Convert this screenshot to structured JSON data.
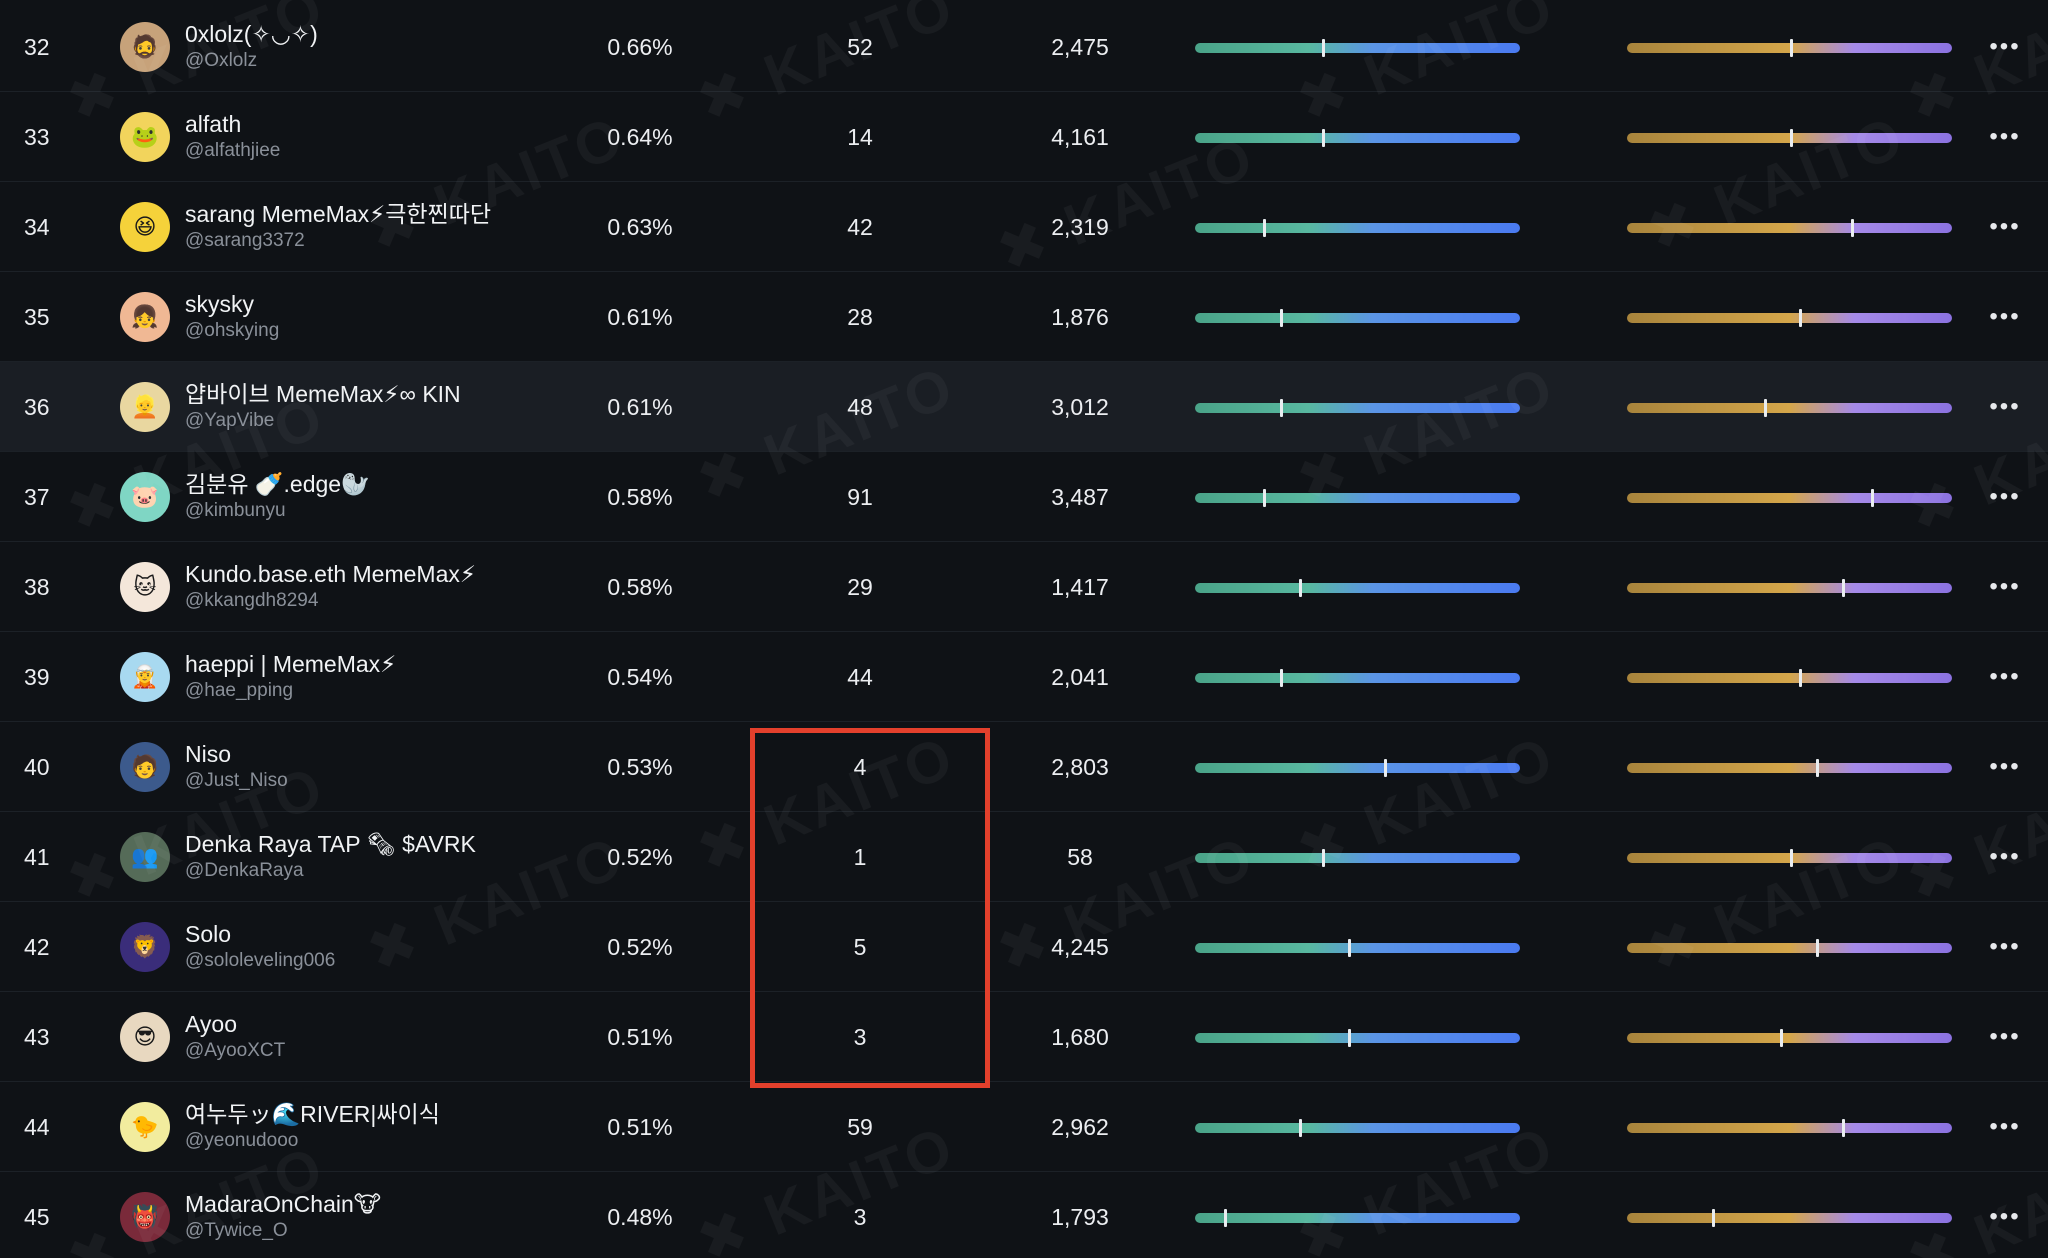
{
  "watermark_text": "✖ KAITO",
  "more_label": "•••",
  "rows": [
    {
      "rank": "32",
      "name": "0xlolz(✧◡✧)",
      "handle": "@Oxlolz",
      "share": "0.66%",
      "count": "52",
      "followers": "2,475",
      "bar_a": 0.39,
      "bar_b": 0.5,
      "avatar_color": "#c7a27a",
      "avatar_glyph": "🧔",
      "highlight": false
    },
    {
      "rank": "33",
      "name": "alfath",
      "handle": "@alfathjiee",
      "share": "0.64%",
      "count": "14",
      "followers": "4,161",
      "bar_a": 0.39,
      "bar_b": 0.5,
      "avatar_color": "#f2d45c",
      "avatar_glyph": "🐸",
      "highlight": false
    },
    {
      "rank": "34",
      "name": "sarang MemeMax⚡극한찐따단",
      "handle": "@sarang3372",
      "share": "0.63%",
      "count": "42",
      "followers": "2,319",
      "bar_a": 0.21,
      "bar_b": 0.69,
      "avatar_color": "#f5d23a",
      "avatar_glyph": "😆",
      "highlight": false
    },
    {
      "rank": "35",
      "name": "skysky",
      "handle": "@ohskying",
      "share": "0.61%",
      "count": "28",
      "followers": "1,876",
      "bar_a": 0.26,
      "bar_b": 0.53,
      "avatar_color": "#f0b894",
      "avatar_glyph": "👧",
      "highlight": false
    },
    {
      "rank": "36",
      "name": "얍바이브 MemeMax⚡∞ KIN",
      "handle": "@YapVibe",
      "share": "0.61%",
      "count": "48",
      "followers": "3,012",
      "bar_a": 0.26,
      "bar_b": 0.42,
      "avatar_color": "#e9d7a0",
      "avatar_glyph": "👱",
      "highlight": true
    },
    {
      "rank": "37",
      "name": "김분유 🍼.edge🦭",
      "handle": "@kimbunyu",
      "share": "0.58%",
      "count": "91",
      "followers": "3,487",
      "bar_a": 0.21,
      "bar_b": 0.75,
      "avatar_color": "#7fd6c4",
      "avatar_glyph": "🐷",
      "highlight": false
    },
    {
      "rank": "38",
      "name": "Kundo.base.eth MemeMax⚡",
      "handle": "@kkangdh8294",
      "share": "0.58%",
      "count": "29",
      "followers": "1,417",
      "bar_a": 0.32,
      "bar_b": 0.66,
      "avatar_color": "#f4e7da",
      "avatar_glyph": "🐱",
      "highlight": false
    },
    {
      "rank": "39",
      "name": "haeppi | MemeMax⚡",
      "handle": "@hae_pping",
      "share": "0.54%",
      "count": "44",
      "followers": "2,041",
      "bar_a": 0.26,
      "bar_b": 0.53,
      "avatar_color": "#a8d9f0",
      "avatar_glyph": "🧝",
      "highlight": false
    },
    {
      "rank": "40",
      "name": "Niso",
      "handle": "@Just_Niso",
      "share": "0.53%",
      "count": "4",
      "followers": "2,803",
      "bar_a": 0.58,
      "bar_b": 0.58,
      "avatar_color": "#3c5a8c",
      "avatar_glyph": "🧑",
      "highlight": false
    },
    {
      "rank": "41",
      "name": "Denka Raya TAP 🗞 $AVRK",
      "handle": "@DenkaRaya",
      "share": "0.52%",
      "count": "1",
      "followers": "58",
      "bar_a": 0.39,
      "bar_b": 0.5,
      "avatar_color": "#556b58",
      "avatar_glyph": "👥",
      "highlight": false
    },
    {
      "rank": "42",
      "name": "Solo",
      "handle": "@sololeveling006",
      "share": "0.52%",
      "count": "5",
      "followers": "4,245",
      "bar_a": 0.47,
      "bar_b": 0.58,
      "avatar_color": "#3a2d7a",
      "avatar_glyph": "🦁",
      "highlight": false
    },
    {
      "rank": "43",
      "name": "Ayoo",
      "handle": "@AyooXCT",
      "share": "0.51%",
      "count": "3",
      "followers": "1,680",
      "bar_a": 0.47,
      "bar_b": 0.47,
      "avatar_color": "#e8d8c0",
      "avatar_glyph": "😎",
      "highlight": false
    },
    {
      "rank": "44",
      "name": "여누두ッ🌊RIVER|싸이식",
      "handle": "@yeonudooo",
      "share": "0.51%",
      "count": "59",
      "followers": "2,962",
      "bar_a": 0.32,
      "bar_b": 0.66,
      "avatar_color": "#f2ec9e",
      "avatar_glyph": "🐤",
      "highlight": false
    },
    {
      "rank": "45",
      "name": "MadaraOnChain🐮",
      "handle": "@Tywice_O",
      "share": "0.48%",
      "count": "3",
      "followers": "1,793",
      "bar_a": 0.09,
      "bar_b": 0.26,
      "avatar_color": "#7a2a3a",
      "avatar_glyph": "👹",
      "highlight": false
    }
  ]
}
